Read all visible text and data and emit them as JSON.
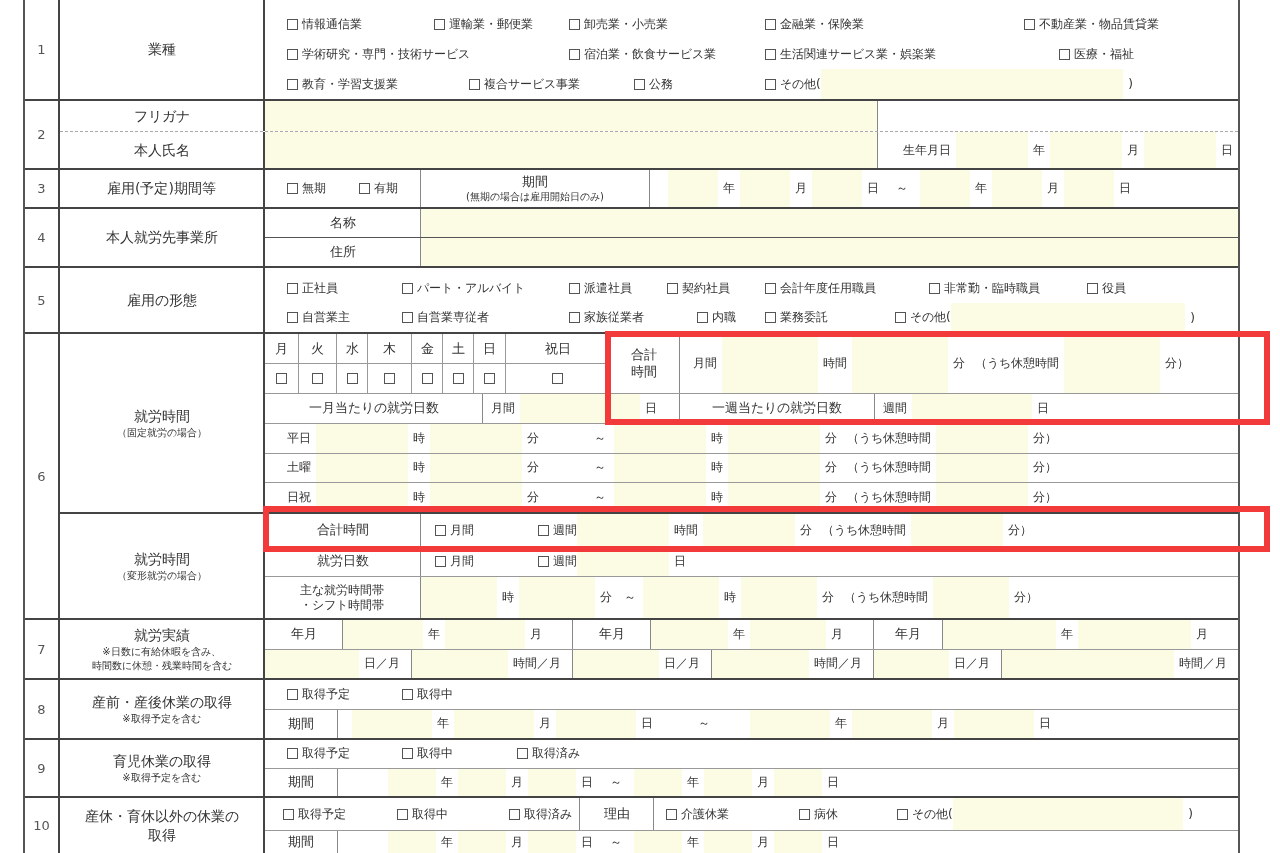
{
  "sections": [
    {
      "number": "1",
      "groups": [
        {
          "label": "業種",
          "lines": [
            {
              "kind": "options",
              "cells": [
                {
                  "kind": "body",
                  "items": [
                    {
                      "kind": "checkbox",
                      "label": "情報通信業",
                      "checked": false
                    },
                    {
                      "kind": "checkbox",
                      "label": "運輸業・郵便業",
                      "checked": false
                    },
                    {
                      "kind": "checkbox",
                      "label": "卸売業・小売業",
                      "checked": false
                    },
                    {
                      "kind": "checkbox",
                      "label": "金融業・保険業",
                      "checked": false
                    },
                    {
                      "kind": "checkbox",
                      "label": "不動産業・物品賃貸業",
                      "checked": false
                    }
                  ]
                }
              ]
            },
            {
              "kind": "options",
              "cells": [
                {
                  "kind": "body",
                  "items": [
                    {
                      "kind": "checkbox",
                      "label": "学術研究・専門・技術サービス",
                      "checked": false
                    },
                    {
                      "kind": "checkbox",
                      "label": "宿泊業・飲食サービス業",
                      "checked": false
                    },
                    {
                      "kind": "checkbox",
                      "label": "生活関連サービス業・娯楽業",
                      "checked": false
                    },
                    {
                      "kind": "checkbox",
                      "label": "医療・福祉",
                      "checked": false
                    }
                  ]
                }
              ]
            },
            {
              "kind": "options",
              "cells": [
                {
                  "kind": "body",
                  "items": [
                    {
                      "kind": "checkbox",
                      "label": "教育・学習支援業",
                      "checked": false
                    },
                    {
                      "kind": "checkbox",
                      "label": "複合サービス事業",
                      "checked": false
                    },
                    {
                      "kind": "checkbox",
                      "label": "公務",
                      "checked": false
                    },
                    {
                      "kind": "checkbox",
                      "label": "その他(",
                      "checked": false
                    },
                    {
                      "kind": "field"
                    },
                    {
                      "kind": "unit",
                      "text": ")"
                    }
                  ]
                }
              ]
            }
          ]
        }
      ]
    },
    {
      "number": "2",
      "groups": [
        {
          "label": "フリガナ",
          "lines": [
            {
              "kind": "name",
              "cells": [
                {
                  "kind": "body",
                  "items": [
                    {
                      "kind": "field"
                    }
                  ]
                },
                {
                  "kind": "blank"
                }
              ]
            }
          ]
        },
        {
          "label": "本人氏名",
          "lines": [
            {
              "kind": "name",
              "cells": [
                {
                  "kind": "body",
                  "items": [
                    {
                      "kind": "field"
                    }
                  ]
                },
                {
                  "kind": "body",
                  "items": [
                    {
                      "kind": "text",
                      "text": "生年月日"
                    },
                    {
                      "kind": "field"
                    },
                    {
                      "kind": "unit",
                      "text": "年"
                    },
                    {
                      "kind": "field"
                    },
                    {
                      "kind": "unit",
                      "text": "月"
                    },
                    {
                      "kind": "field"
                    },
                    {
                      "kind": "unit",
                      "text": "日"
                    }
                  ]
                }
              ]
            }
          ]
        }
      ]
    },
    {
      "number": "3",
      "groups": [
        {
          "label": "雇用(予定)期間等",
          "lines": [
            {
              "kind": "term",
              "cells": [
                {
                  "kind": "body",
                  "items": [
                    {
                      "kind": "checkbox",
                      "label": "無期",
                      "checked": false
                    },
                    {
                      "kind": "checkbox",
                      "label": "有期",
                      "checked": false
                    }
                  ]
                },
                {
                  "kind": "head",
                  "text": "期間",
                  "note": "(無期の場合は雇用開始日のみ)"
                },
                {
                  "kind": "body",
                  "items": [
                    {
                      "kind": "field"
                    },
                    {
                      "kind": "unit",
                      "text": "年"
                    },
                    {
                      "kind": "field"
                    },
                    {
                      "kind": "unit",
                      "text": "月"
                    },
                    {
                      "kind": "field"
                    },
                    {
                      "kind": "unit",
                      "text": "日"
                    },
                    {
                      "kind": "sep",
                      "text": "～"
                    },
                    {
                      "kind": "field"
                    },
                    {
                      "kind": "unit",
                      "text": "年"
                    },
                    {
                      "kind": "field"
                    },
                    {
                      "kind": "unit",
                      "text": "月"
                    },
                    {
                      "kind": "field"
                    },
                    {
                      "kind": "unit",
                      "text": "日"
                    }
                  ]
                }
              ]
            }
          ]
        }
      ]
    },
    {
      "number": "4",
      "groups": [
        {
          "label": "本人就労先事業所",
          "lines": [
            {
              "kind": "place",
              "cells": [
                {
                  "kind": "head",
                  "text": "名称"
                },
                {
                  "kind": "body",
                  "items": [
                    {
                      "kind": "field"
                    }
                  ]
                }
              ]
            },
            {
              "kind": "place",
              "cells": [
                {
                  "kind": "head",
                  "text": "住所"
                },
                {
                  "kind": "body",
                  "items": [
                    {
                      "kind": "field"
                    }
                  ]
                }
              ]
            }
          ]
        }
      ]
    },
    {
      "number": "5",
      "groups": [
        {
          "label": "雇用の形態",
          "lines": [
            {
              "kind": "options",
              "cells": [
                {
                  "kind": "body",
                  "items": [
                    {
                      "kind": "checkbox",
                      "label": "正社員",
                      "checked": false
                    },
                    {
                      "kind": "checkbox",
                      "label": "パート・アルバイト",
                      "checked": false
                    },
                    {
                      "kind": "checkbox",
                      "label": "派遣社員",
                      "checked": false
                    },
                    {
                      "kind": "checkbox",
                      "label": "契約社員",
                      "checked": false
                    },
                    {
                      "kind": "checkbox",
                      "label": "会計年度任用職員",
                      "checked": false
                    },
                    {
                      "kind": "checkbox",
                      "label": "非常勤・臨時職員",
                      "checked": false
                    },
                    {
                      "kind": "checkbox",
                      "label": "役員",
                      "checked": false
                    }
                  ]
                }
              ]
            },
            {
              "kind": "options",
              "cells": [
                {
                  "kind": "body",
                  "items": [
                    {
                      "kind": "checkbox",
                      "label": "自営業主",
                      "checked": false
                    },
                    {
                      "kind": "checkbox",
                      "label": "自営業専従者",
                      "checked": false
                    },
                    {
                      "kind": "checkbox",
                      "label": "家族従業者",
                      "checked": false
                    },
                    {
                      "kind": "checkbox",
                      "label": "内職",
                      "checked": false
                    },
                    {
                      "kind": "checkbox",
                      "label": "業務委託",
                      "checked": false
                    },
                    {
                      "kind": "checkbox",
                      "label": "その他(",
                      "checked": false
                    },
                    {
                      "kind": "field"
                    },
                    {
                      "kind": "unit",
                      "text": ")"
                    }
                  ]
                }
              ]
            }
          ]
        }
      ]
    },
    {
      "number": "6",
      "groups": [
        {
          "label": "就労時間",
          "notes": [
            "（固定就労の場合）"
          ],
          "lines": [
            {
              "kind": "week",
              "days": [
                {
                  "label": "月",
                  "checked": false
                },
                {
                  "label": "火",
                  "checked": false
                },
                {
                  "label": "水",
                  "checked": false
                },
                {
                  "label": "木",
                  "checked": false
                },
                {
                  "label": "金",
                  "checked": false
                },
                {
                  "label": "土",
                  "checked": false
                },
                {
                  "label": "日",
                  "checked": false
                },
                {
                  "label": "祝日",
                  "checked": false
                }
              ],
              "cells": [
                {
                  "kind": "head",
                  "text": "合計時間"
                },
                {
                  "kind": "body",
                  "items": [
                    {
                      "kind": "text",
                      "text": "月間"
                    },
                    {
                      "kind": "field"
                    },
                    {
                      "kind": "unit",
                      "text": "時間"
                    },
                    {
                      "kind": "field"
                    },
                    {
                      "kind": "unit",
                      "text": "分"
                    },
                    {
                      "kind": "text",
                      "text": "（うち休憩時間"
                    },
                    {
                      "kind": "field"
                    },
                    {
                      "kind": "unit",
                      "text": "分）"
                    }
                  ]
                }
              ]
            },
            {
              "kind": "days",
              "cells": [
                {
                  "kind": "head",
                  "text": "一月当たりの就労日数"
                },
                {
                  "kind": "body",
                  "items": [
                    {
                      "kind": "text",
                      "text": "月間"
                    },
                    {
                      "kind": "field"
                    },
                    {
                      "kind": "unit",
                      "text": "日"
                    }
                  ]
                },
                {
                  "kind": "head",
                  "text": "一週当たりの就労日数"
                },
                {
                  "kind": "body",
                  "items": [
                    {
                      "kind": "text",
                      "text": "週間"
                    },
                    {
                      "kind": "field"
                    },
                    {
                      "kind": "unit",
                      "text": "日"
                    }
                  ]
                }
              ]
            },
            {
              "kind": "time",
              "cells": [
                {
                  "kind": "body",
                  "items": [
                    {
                      "kind": "text",
                      "text": "平日"
                    },
                    {
                      "kind": "field"
                    },
                    {
                      "kind": "unit",
                      "text": "時"
                    },
                    {
                      "kind": "field"
                    },
                    {
                      "kind": "unit",
                      "text": "分"
                    },
                    {
                      "kind": "sep",
                      "text": "～"
                    },
                    {
                      "kind": "field"
                    },
                    {
                      "kind": "unit",
                      "text": "時"
                    },
                    {
                      "kind": "field"
                    },
                    {
                      "kind": "unit",
                      "text": "分"
                    },
                    {
                      "kind": "text",
                      "text": "（うち休憩時間"
                    },
                    {
                      "kind": "field"
                    },
                    {
                      "kind": "unit",
                      "text": "分）"
                    }
                  ]
                }
              ]
            },
            {
              "kind": "time",
              "cells": [
                {
                  "kind": "body",
                  "items": [
                    {
                      "kind": "text",
                      "text": "土曜"
                    },
                    {
                      "kind": "field"
                    },
                    {
                      "kind": "unit",
                      "text": "時"
                    },
                    {
                      "kind": "field"
                    },
                    {
                      "kind": "unit",
                      "text": "分"
                    },
                    {
                      "kind": "sep",
                      "text": "～"
                    },
                    {
                      "kind": "field"
                    },
                    {
                      "kind": "unit",
                      "text": "時"
                    },
                    {
                      "kind": "field"
                    },
                    {
                      "kind": "unit",
                      "text": "分"
                    },
                    {
                      "kind": "text",
                      "text": "（うち休憩時間"
                    },
                    {
                      "kind": "field"
                    },
                    {
                      "kind": "unit",
                      "text": "分）"
                    }
                  ]
                }
              ]
            },
            {
              "kind": "time",
              "cells": [
                {
                  "kind": "body",
                  "items": [
                    {
                      "kind": "text",
                      "text": "日祝"
                    },
                    {
                      "kind": "field"
                    },
                    {
                      "kind": "unit",
                      "text": "時"
                    },
                    {
                      "kind": "field"
                    },
                    {
                      "kind": "unit",
                      "text": "分"
                    },
                    {
                      "kind": "sep",
                      "text": "～"
                    },
                    {
                      "kind": "field"
                    },
                    {
                      "kind": "unit",
                      "text": "時"
                    },
                    {
                      "kind": "field"
                    },
                    {
                      "kind": "unit",
                      "text": "分"
                    },
                    {
                      "kind": "text",
                      "text": "（うち休憩時間"
                    },
                    {
                      "kind": "field"
                    },
                    {
                      "kind": "unit",
                      "text": "分）"
                    }
                  ]
                }
              ]
            }
          ]
        },
        {
          "label": "就労時間",
          "notes": [
            "（変形就労の場合）"
          ],
          "lines": [
            {
              "kind": "vtotal",
              "cells": [
                {
                  "kind": "head",
                  "text": "合計時間"
                },
                {
                  "kind": "body",
                  "items": [
                    {
                      "kind": "checkbox",
                      "label": "月間",
                      "checked": false
                    },
                    {
                      "kind": "checkbox",
                      "label": "週間",
                      "checked": false
                    },
                    {
                      "kind": "field"
                    },
                    {
                      "kind": "unit",
                      "text": "時間"
                    },
                    {
                      "kind": "field"
                    },
                    {
                      "kind": "unit",
                      "text": "分"
                    },
                    {
                      "kind": "text",
                      "text": "（うち休憩時間"
                    },
                    {
                      "kind": "field"
                    },
                    {
                      "kind": "unit",
                      "text": "分）"
                    }
                  ]
                }
              ]
            },
            {
              "kind": "vdays",
              "cells": [
                {
                  "kind": "head",
                  "text": "就労日数"
                },
                {
                  "kind": "body",
                  "items": [
                    {
                      "kind": "checkbox",
                      "label": "月間",
                      "checked": false
                    },
                    {
                      "kind": "checkbox",
                      "label": "週間",
                      "checked": false
                    },
                    {
                      "kind": "field"
                    },
                    {
                      "kind": "unit",
                      "text": "日"
                    }
                  ]
                }
              ]
            },
            {
              "kind": "shift",
              "cells": [
                {
                  "kind": "head",
                  "text": "主な就労時間帯・シフト時間帯"
                },
                {
                  "kind": "body",
                  "items": [
                    {
                      "kind": "field"
                    },
                    {
                      "kind": "unit",
                      "text": "時"
                    },
                    {
                      "kind": "field"
                    },
                    {
                      "kind": "unit",
                      "text": "分"
                    },
                    {
                      "kind": "sep",
                      "text": "～"
                    },
                    {
                      "kind": "field"
                    },
                    {
                      "kind": "unit",
                      "text": "時"
                    },
                    {
                      "kind": "field"
                    },
                    {
                      "kind": "unit",
                      "text": "分"
                    },
                    {
                      "kind": "text",
                      "text": "（うち休憩時間"
                    },
                    {
                      "kind": "field"
                    },
                    {
                      "kind": "unit",
                      "text": "分）"
                    }
                  ]
                }
              ]
            }
          ]
        }
      ]
    },
    {
      "number": "7",
      "groups": [
        {
          "label": "就労実績",
          "notes": [
            "※日数に有給休暇を含み、",
            "時間数に休憩・残業時間を含む"
          ],
          "lines": [
            {
              "kind": "record",
              "cells": [
                {
                  "kind": "head",
                  "text": "年月"
                },
                {
                  "kind": "body",
                  "items": [
                    {
                      "kind": "field"
                    },
                    {
                      "kind": "unit",
                      "text": "年"
                    },
                    {
                      "kind": "field"
                    },
                    {
                      "kind": "unit",
                      "text": "月"
                    }
                  ]
                },
                {
                  "kind": "head",
                  "text": "年月"
                },
                {
                  "kind": "body",
                  "items": [
                    {
                      "kind": "field"
                    },
                    {
                      "kind": "unit",
                      "text": "年"
                    },
                    {
                      "kind": "field"
                    },
                    {
                      "kind": "unit",
                      "text": "月"
                    }
                  ]
                },
                {
                  "kind": "head",
                  "text": "年月"
                },
                {
                  "kind": "body",
                  "items": [
                    {
                      "kind": "field"
                    },
                    {
                      "kind": "unit",
                      "text": "年"
                    },
                    {
                      "kind": "field"
                    },
                    {
                      "kind": "unit",
                      "text": "月"
                    }
                  ]
                }
              ]
            },
            {
              "kind": "record2",
              "cells": [
                {
                  "kind": "body",
                  "items": [
                    {
                      "kind": "field"
                    },
                    {
                      "kind": "unit",
                      "text": "日／月"
                    }
                  ]
                },
                {
                  "kind": "body",
                  "items": [
                    {
                      "kind": "field"
                    },
                    {
                      "kind": "unit",
                      "text": "時間／月"
                    }
                  ]
                },
                {
                  "kind": "body",
                  "items": [
                    {
                      "kind": "field"
                    },
                    {
                      "kind": "unit",
                      "text": "日／月"
                    }
                  ]
                },
                {
                  "kind": "body",
                  "items": [
                    {
                      "kind": "field"
                    },
                    {
                      "kind": "unit",
                      "text": "時間／月"
                    }
                  ]
                },
                {
                  "kind": "body",
                  "items": [
                    {
                      "kind": "field"
                    },
                    {
                      "kind": "unit",
                      "text": "日／月"
                    }
                  ]
                },
                {
                  "kind": "body",
                  "items": [
                    {
                      "kind": "field"
                    },
                    {
                      "kind": "unit",
                      "text": "時間／月"
                    }
                  ]
                }
              ]
            }
          ]
        }
      ]
    },
    {
      "number": "8",
      "groups": [
        {
          "label": "産前・産後休業の取得",
          "notes": [
            "※取得予定を含む"
          ],
          "lines": [
            {
              "kind": "options",
              "cells": [
                {
                  "kind": "body",
                  "items": [
                    {
                      "kind": "checkbox",
                      "label": "取得予定",
                      "checked": false
                    },
                    {
                      "kind": "checkbox",
                      "label": "取得中",
                      "checked": false
                    }
                  ]
                }
              ]
            },
            {
              "kind": "period",
              "cells": [
                {
                  "kind": "head",
                  "text": "期間"
                },
                {
                  "kind": "body",
                  "items": [
                    {
                      "kind": "field"
                    },
                    {
                      "kind": "unit",
                      "text": "年"
                    },
                    {
                      "kind": "field"
                    },
                    {
                      "kind": "unit",
                      "text": "月"
                    },
                    {
                      "kind": "field"
                    },
                    {
                      "kind": "unit",
                      "text": "日"
                    },
                    {
                      "kind": "sep",
                      "text": "～"
                    },
                    {
                      "kind": "field"
                    },
                    {
                      "kind": "unit",
                      "text": "年"
                    },
                    {
                      "kind": "field"
                    },
                    {
                      "kind": "unit",
                      "text": "月"
                    },
                    {
                      "kind": "field"
                    },
                    {
                      "kind": "unit",
                      "text": "日"
                    }
                  ]
                }
              ]
            }
          ]
        }
      ]
    },
    {
      "number": "9",
      "groups": [
        {
          "label": "育児休業の取得",
          "notes": [
            "※取得予定を含む"
          ],
          "lines": [
            {
              "kind": "options",
              "cells": [
                {
                  "kind": "body",
                  "items": [
                    {
                      "kind": "checkbox",
                      "label": "取得予定",
                      "checked": false
                    },
                    {
                      "kind": "checkbox",
                      "label": "取得中",
                      "checked": false
                    },
                    {
                      "kind": "checkbox",
                      "label": "取得済み",
                      "checked": false
                    }
                  ]
                }
              ]
            },
            {
              "kind": "period",
              "cells": [
                {
                  "kind": "head",
                  "text": "期間"
                },
                {
                  "kind": "body",
                  "items": [
                    {
                      "kind": "field"
                    },
                    {
                      "kind": "unit",
                      "text": "年"
                    },
                    {
                      "kind": "field"
                    },
                    {
                      "kind": "unit",
                      "text": "月"
                    },
                    {
                      "kind": "field"
                    },
                    {
                      "kind": "unit",
                      "text": "日"
                    },
                    {
                      "kind": "sep",
                      "text": "～"
                    },
                    {
                      "kind": "field"
                    },
                    {
                      "kind": "unit",
                      "text": "年"
                    },
                    {
                      "kind": "field"
                    },
                    {
                      "kind": "unit",
                      "text": "月"
                    },
                    {
                      "kind": "field"
                    },
                    {
                      "kind": "unit",
                      "text": "日"
                    }
                  ]
                }
              ]
            }
          ]
        }
      ]
    },
    {
      "number": "10",
      "groups": [
        {
          "label": "産休・育休以外の休業の取得",
          "lines": [
            {
              "kind": "leave",
              "cells": [
                {
                  "kind": "body",
                  "items": [
                    {
                      "kind": "checkbox",
                      "label": "取得予定",
                      "checked": false
                    },
                    {
                      "kind": "checkbox",
                      "label": "取得中",
                      "checked": false
                    },
                    {
                      "kind": "checkbox",
                      "label": "取得済み",
                      "checked": false
                    }
                  ]
                },
                {
                  "kind": "head",
                  "text": "理由"
                },
                {
                  "kind": "body",
                  "items": [
                    {
                      "kind": "checkbox",
                      "label": "介護休業",
                      "checked": false
                    },
                    {
                      "kind": "checkbox",
                      "label": "病休",
                      "checked": false
                    },
                    {
                      "kind": "checkbox",
                      "label": "その他(",
                      "checked": false
                    },
                    {
                      "kind": "field"
                    },
                    {
                      "kind": "unit",
                      "text": ")"
                    }
                  ]
                }
              ]
            },
            {
              "kind": "period",
              "cells": [
                {
                  "kind": "head",
                  "text": "期間"
                },
                {
                  "kind": "body",
                  "items": [
                    {
                      "kind": "field"
                    },
                    {
                      "kind": "unit",
                      "text": "年"
                    },
                    {
                      "kind": "field"
                    },
                    {
                      "kind": "unit",
                      "text": "月"
                    },
                    {
                      "kind": "field"
                    },
                    {
                      "kind": "unit",
                      "text": "日"
                    },
                    {
                      "kind": "sep",
                      "text": "～"
                    },
                    {
                      "kind": "field"
                    },
                    {
                      "kind": "unit",
                      "text": "年"
                    },
                    {
                      "kind": "field"
                    },
                    {
                      "kind": "unit",
                      "text": "月"
                    },
                    {
                      "kind": "field"
                    },
                    {
                      "kind": "unit",
                      "text": "日"
                    }
                  ]
                }
              ]
            }
          ]
        }
      ]
    }
  ]
}
